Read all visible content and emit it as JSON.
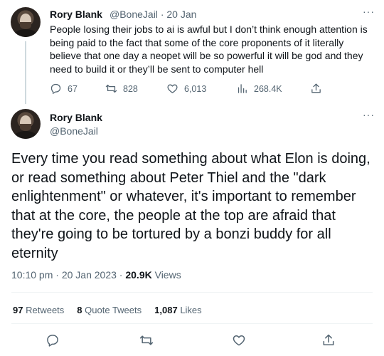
{
  "reply_tweet": {
    "author_name": "Rory Blank",
    "author_handle": "@BoneJail",
    "date": "20 Jan",
    "text": "People losing their jobs to ai is awful but I don’t think enough attention is being paid to the fact that some of the core proponents of it literally believe that one day a neopet will be so powerful it will be god and they need to build it or they’ll be sent to computer hell",
    "replies": "67",
    "retweets": "828",
    "likes": "6,013",
    "views": "268.4K",
    "more_label": "···"
  },
  "main_tweet": {
    "author_name": "Rory Blank",
    "author_handle": "@BoneJail",
    "more_label": "···",
    "text": "Every time you read something about what Elon is doing, or read something about Peter Thiel and the \"dark enlightenment\" or whatever, it's important to remember that at the core, the people at the top are afraid that they're going to be tortured by a bonzi buddy for all eternity",
    "time": "10:10 pm",
    "date": "20 Jan 2023",
    "views_count": "20.9K",
    "views_label": "Views",
    "stats": {
      "retweets_count": "97",
      "retweets_label": "Retweets",
      "quotes_count": "8",
      "quotes_label": "Quote Tweets",
      "likes_count": "1,087",
      "likes_label": "Likes"
    }
  },
  "icons": [
    "reply-icon",
    "retweet-icon",
    "like-icon",
    "views-icon",
    "share-icon"
  ],
  "colors": {
    "text": "#0f1419",
    "secondary": "#536471",
    "divider": "#eff3f4",
    "thread": "#cfd9de"
  }
}
